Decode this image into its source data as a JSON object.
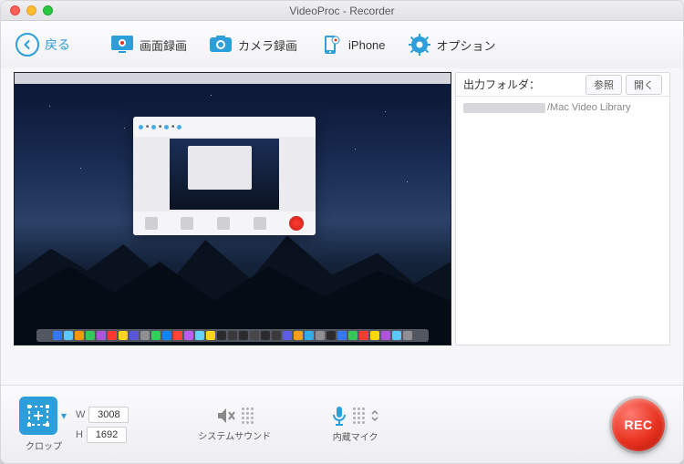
{
  "window": {
    "title": "VideoProc - Recorder"
  },
  "toolbar": {
    "back_label": "戻る",
    "tabs": [
      {
        "label": "画面録画"
      },
      {
        "label": "カメラ録画"
      },
      {
        "label": "iPhone"
      },
      {
        "label": "オプション"
      }
    ]
  },
  "sidebar": {
    "header_label": "出力フォルダ：",
    "browse_label": "参照",
    "open_label": "開く",
    "path_suffix": "/Mac Video Library"
  },
  "bottom": {
    "crop_label": "クロップ",
    "width_label": "W",
    "height_label": "H",
    "width_value": "3008",
    "height_value": "1692",
    "system_sound_label": "システムサウンド",
    "mic_label": "内蔵マイク",
    "rec_label": "REC"
  },
  "colors": {
    "accent": "#2c9ed9",
    "rec": "#e8321f"
  }
}
